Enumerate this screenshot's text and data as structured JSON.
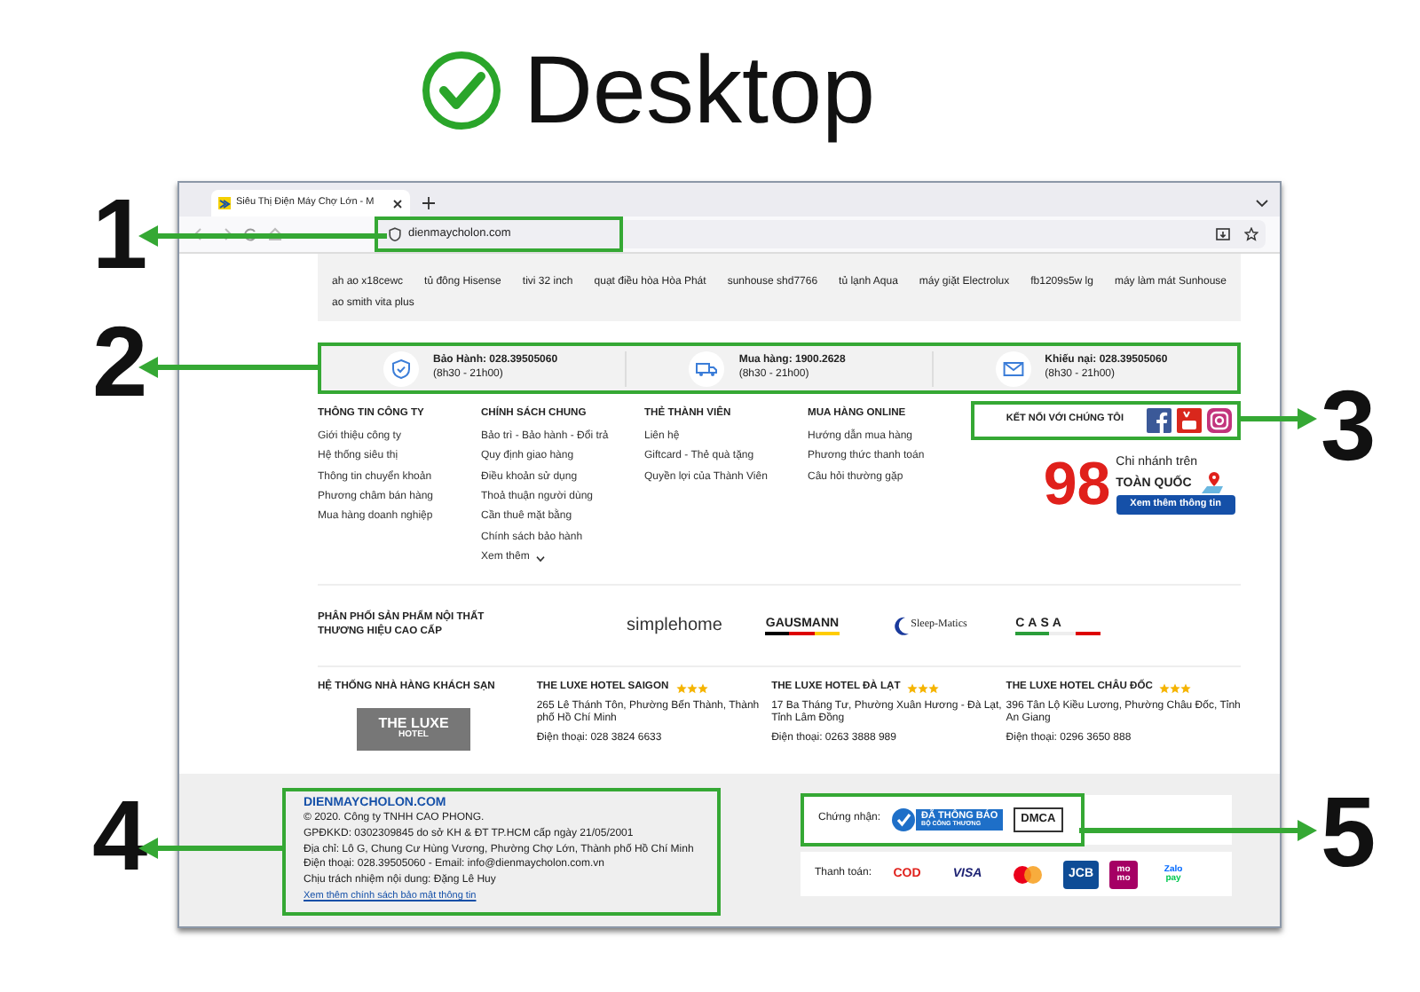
{
  "heading": {
    "title": "Desktop"
  },
  "callouts": [
    {
      "number": "1"
    },
    {
      "number": "2"
    },
    {
      "number": "3"
    },
    {
      "number": "4"
    },
    {
      "number": "5"
    }
  ],
  "browser": {
    "tab_title": "Siêu Thị Điện Máy Chợ Lớn - M",
    "address": "dienmaycholon.com"
  },
  "search_tags": [
    "ah ao x18cewc",
    "tủ đông Hisense",
    "tivi 32 inch",
    "quạt điều hòa Hòa Phát",
    "sunhouse shd7766",
    "tủ lạnh Aqua",
    "máy giặt Electrolux",
    "fb1209s5w lg",
    "máy làm mát Sunhouse",
    "ao smith vita plus"
  ],
  "services": [
    {
      "kind": "shield",
      "label": "Bảo Hành: 028.39505060",
      "hours": "(8h30 - 21h00)"
    },
    {
      "kind": "truck",
      "label": "Mua hàng: 1900.2628",
      "hours": "(8h30 - 21h00)"
    },
    {
      "kind": "mail",
      "label": "Khiếu nại: 028.39505060",
      "hours": "(8h30 - 21h00)"
    }
  ],
  "footer_columns": [
    {
      "title": "THÔNG TIN CÔNG TY",
      "links": [
        "Giới thiệu công ty",
        "Hệ thống siêu thị",
        "Thông tin chuyển khoản",
        "Phương châm bán hàng",
        "Mua hàng doanh nghiệp"
      ]
    },
    {
      "title": "CHÍNH SÁCH CHUNG",
      "links": [
        "Bảo trì - Bảo hành - Đổi trả",
        "Quy định giao hàng",
        "Điều khoản sử dụng",
        "Thoả thuận người dùng",
        "Cần thuê mặt bằng",
        "Chính sách bảo hành"
      ],
      "more": "Xem thêm"
    },
    {
      "title": "THẺ THÀNH VIÊN",
      "links": [
        "Liên hệ",
        "Giftcard - Thẻ quà tặng",
        "Quyền lợi của Thành Viên"
      ]
    },
    {
      "title": "MUA HÀNG ONLINE",
      "links": [
        "Hướng dẫn mua hàng",
        "Phương thức thanh toán",
        "Câu hỏi thường gặp"
      ]
    }
  ],
  "social": {
    "title": "KẾT NỐI VỚI CHÚNG TÔI"
  },
  "branches": {
    "number": "98",
    "line1": "Chi nhánh trên",
    "line2": "TOÀN QUỐC",
    "button": "Xem thêm thông tin"
  },
  "distribution": {
    "title_lines": [
      "PHÂN PHỐI SẢN PHẨM NỘI THẤT",
      "THƯƠNG HIỆU CAO CẤP"
    ],
    "brands": [
      {
        "kind": "simplehome",
        "text": "simplehome"
      },
      {
        "kind": "gausmann",
        "text": "GAUSMANN"
      },
      {
        "kind": "sleepmatics",
        "text": "Sleep-Matics"
      },
      {
        "kind": "casa",
        "text": "CASA"
      }
    ]
  },
  "hotels": {
    "title": "HỆ THỐNG NHÀ HÀNG KHÁCH SẠN",
    "logo_lines": [
      "THE LUXE",
      "HOTEL"
    ],
    "items": [
      {
        "name": "THE LUXE HOTEL SAIGON",
        "stars": 3,
        "address": "265 Lê Thánh Tôn, Phường Bến Thành, Thành phố Hồ Chí Minh",
        "phone": "Điện thoại: 028 3824 6633"
      },
      {
        "name": "THE LUXE HOTEL ĐÀ LẠT",
        "stars": 3,
        "address": "17 Ba Tháng Tư, Phường Xuân Hương - Đà Lạt, Tỉnh Lâm Đồng",
        "phone": "Điện thoại: 0263 3888 989"
      },
      {
        "name": "THE LUXE HOTEL CHÂU ĐỐC",
        "stars": 3,
        "address": "396 Tân Lộ Kiều Lương, Phường Châu Đốc, Tỉnh An Giang",
        "phone": "Điện thoại: 0296 3650 888"
      }
    ]
  },
  "company": {
    "name": "DIENMAYCHOLON.COM",
    "lines": [
      "© 2020. Công ty TNHH CAO PHONG.",
      "GPĐKKD: 0302309845 do sở KH & ĐT TP.HCM cấp ngày 21/05/2001",
      "Địa chỉ: Lô G, Chung Cư Hùng Vương, Phường Chợ Lớn, Thành phố Hồ Chí Minh",
      "Điện thoại: 028.39505060 - Email: info@dienmaycholon.com.vn",
      "Chịu trách nhiệm nội dung: Đặng Lê Huy"
    ],
    "link": "Xem thêm chính sách bảo mật thông tin"
  },
  "certification": {
    "label": "Chứng nhận:",
    "badges": [
      {
        "kind": "bct",
        "lines": [
          "ĐÃ THÔNG BÁO",
          "BỘ CÔNG THƯƠNG"
        ]
      },
      {
        "kind": "dmca",
        "lines": [
          "DMCA"
        ]
      }
    ]
  },
  "payment": {
    "label": "Thanh toán:",
    "methods": [
      {
        "kind": "cod",
        "lines": [
          "COD"
        ]
      },
      {
        "kind": "visa",
        "lines": [
          "VISA"
        ]
      },
      {
        "kind": "mastercard"
      },
      {
        "kind": "jcb",
        "lines": [
          "JCB"
        ]
      },
      {
        "kind": "momo",
        "lines": [
          "mo",
          "mo"
        ]
      },
      {
        "kind": "zalopay",
        "lines": [
          "Zalo",
          "pay"
        ]
      }
    ]
  }
}
